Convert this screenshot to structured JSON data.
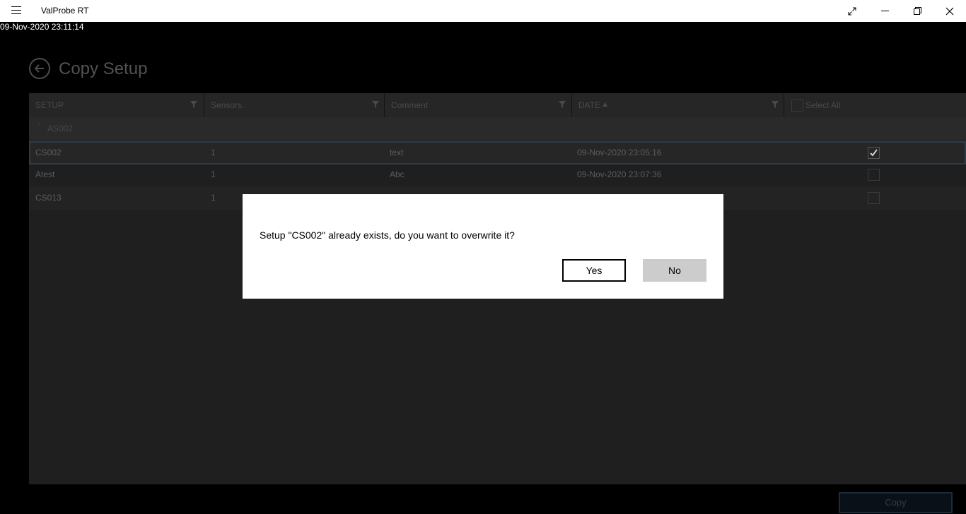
{
  "window": {
    "title": "ValProbe RT"
  },
  "clock": "09-Nov-2020 23:11:14",
  "page": {
    "title": "Copy Setup"
  },
  "grid": {
    "columns": [
      "SETUP",
      "Sensors.",
      "Comment",
      "DATE"
    ],
    "select_all_label": "Select All",
    "group_label": "AS002",
    "rows": [
      {
        "setup": "CS002",
        "sensors": "1",
        "comment": "text",
        "date": "09-Nov-2020 23:05:16",
        "checked": true
      },
      {
        "setup": "Atest",
        "sensors": "1",
        "comment": "Abc",
        "date": "09-Nov-2020 23:07:36",
        "checked": false
      },
      {
        "setup": "CS013",
        "sensors": "1",
        "comment": "",
        "date": "",
        "checked": false
      }
    ]
  },
  "copy_button": "Copy",
  "dialog": {
    "message": "Setup \"CS002\" already exists, do you want to overwrite it?",
    "yes_label": "Yes",
    "no_label": "No"
  },
  "colors": {
    "accent": "#2d3c4a",
    "dialog_bg": "#ffffff",
    "no_button_bg": "#cccccc"
  }
}
